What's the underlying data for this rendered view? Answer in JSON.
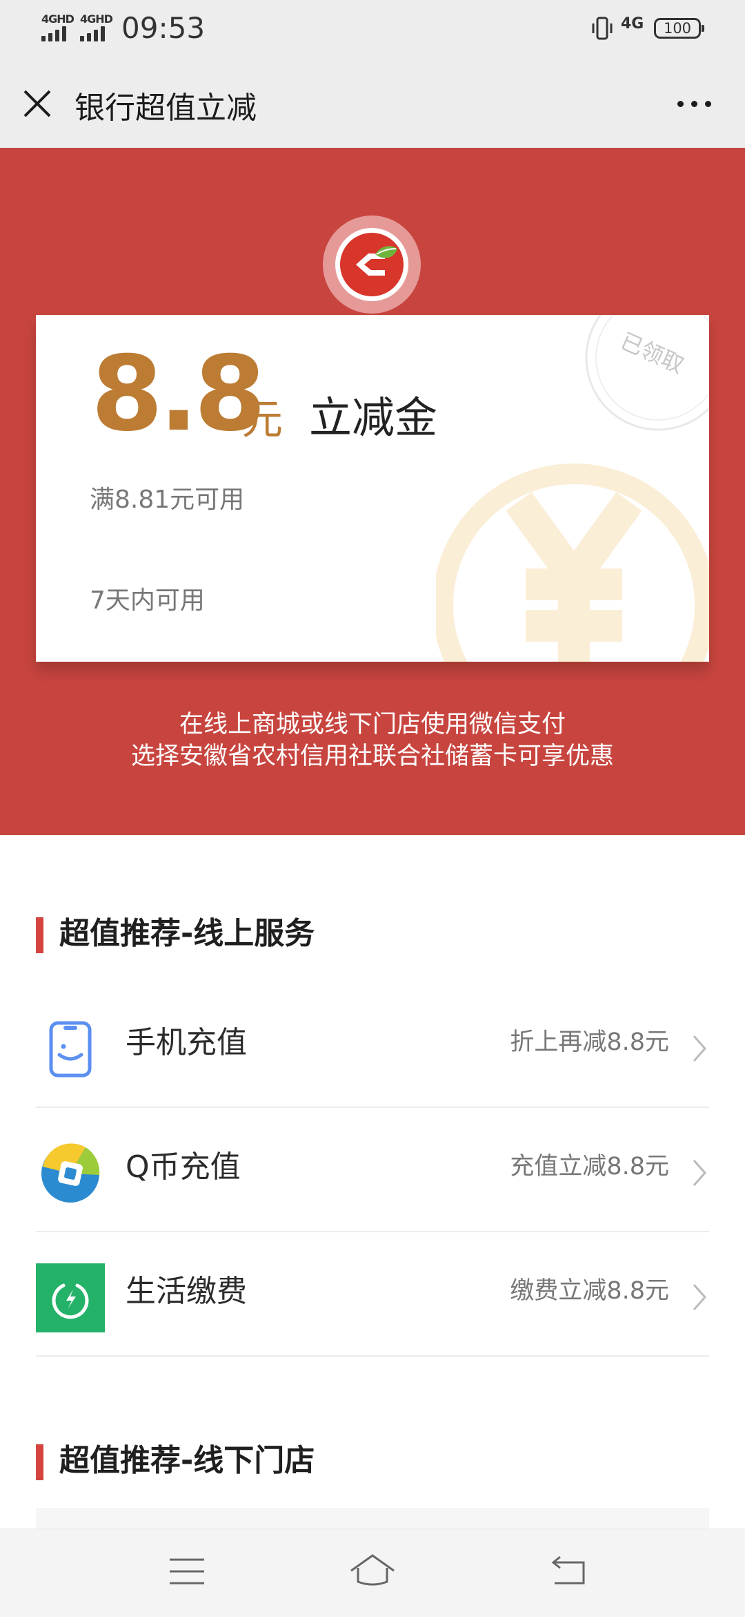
{
  "status_bar": {
    "sim1": "4GHD",
    "sim2": "4GHD",
    "time": "09:53",
    "network": "4G",
    "battery": "100"
  },
  "header": {
    "title": "银行超值立减",
    "close_icon": "close-icon",
    "more_icon": "more-dots-icon"
  },
  "banner": {
    "bg_color": "#c8453f",
    "logo_icon": "bank-logo-icon",
    "coupon": {
      "amount": "8.8",
      "unit": "元",
      "title": "立减金",
      "condition": "满8.81元可用",
      "validity": "7天内可用",
      "stamp": "已领取",
      "accent_color": "#bd7c34"
    },
    "desc_line1": "在线上商城或线下门店使用微信支付",
    "desc_line2": "选择安徽省农村信用社联合社储蓄卡可享优惠"
  },
  "online_section": {
    "title": "超值推荐-线上服务",
    "items": [
      {
        "name": "手机充值",
        "promo": "折上再减8.8元",
        "icon": "phone-recharge-icon"
      },
      {
        "name": "Q币充值",
        "promo": "充值立减8.8元",
        "icon": "qcoin-icon"
      },
      {
        "name": "生活缴费",
        "promo": "缴费立减8.8元",
        "icon": "utility-bill-icon"
      }
    ]
  },
  "offline_section": {
    "title": "超值推荐-线下门店"
  },
  "nav": {
    "menu_icon": "menu-icon",
    "home_icon": "home-icon",
    "back_icon": "back-icon"
  }
}
